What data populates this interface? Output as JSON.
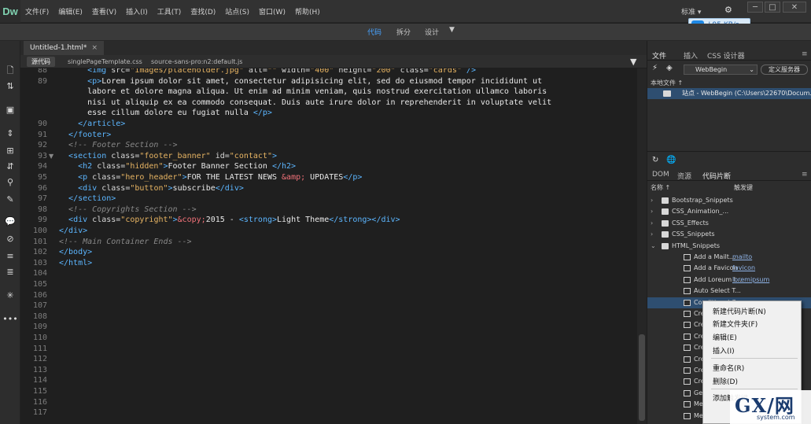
{
  "app": {
    "logo": "Dw"
  },
  "menu": [
    "文件(F)",
    "编辑(E)",
    "查看(V)",
    "插入(I)",
    "工具(T)",
    "查找(D)",
    "站点(S)",
    "窗口(W)",
    "帮助(H)"
  ],
  "workspace": {
    "label": "标准",
    "arrow": "▾"
  },
  "window_controls": [
    "─",
    "□",
    "✕"
  ],
  "speed": {
    "value": "↓95 KB/s"
  },
  "view_modes": {
    "code": "代码",
    "split": "拆分",
    "design": "设计",
    "active": "code"
  },
  "document": {
    "tab": "Untitled-1.html*",
    "close": "×"
  },
  "related_files": [
    "源代码",
    "singlePageTemplate.css",
    "source-sans-pro:n2:default.js"
  ],
  "code_lines": [
    {
      "n": "88",
      "html": "      <span class='tag'>&lt;img</span> <span class='attr'>src=</span><span class='val'>\"images/placeholder.jpg\"</span> <span class='attr'>alt=</span><span class='val'>\"\"</span> <span class='attr'>width=</span><span class='val'>\"400\"</span> <span class='attr'>height=</span><span class='val'>\"200\"</span> <span class='attr'>class=</span><span class='val'>\"cards\"</span> <span class='tag'>/&gt;</span>"
    },
    {
      "n": "89",
      "html": "      <span class='tag'>&lt;p&gt;</span><span class='txt'>Lorem ipsum dolor sit amet, consectetur adipisicing elit, sed do eiusmod tempor incididunt ut</span>"
    },
    {
      "n": "",
      "html": "      <span class='txt'>labore et dolore magna aliqua. Ut enim ad minim veniam, quis nostrud exercitation ullamco laboris</span>"
    },
    {
      "n": "",
      "html": "      <span class='txt'>nisi ut aliquip ex ea commodo consequat. Duis aute irure dolor in reprehenderit in voluptate velit</span>"
    },
    {
      "n": "",
      "html": "      <span class='txt'>esse cillum dolore eu fugiat nulla </span><span class='tag'>&lt;/p&gt;</span>"
    },
    {
      "n": "90",
      "html": "    <span class='tag'>&lt;/article&gt;</span>"
    },
    {
      "n": "91",
      "html": "  <span class='tag'>&lt;/footer&gt;</span>"
    },
    {
      "n": "92",
      "html": "  <span class='cmt'>&lt;!-- Footer Section --&gt;</span>"
    },
    {
      "n": "93",
      "fold": "▼",
      "html": "  <span class='tag'>&lt;section</span> <span class='attr'>class=</span><span class='val'>\"footer_banner\"</span> <span class='attr'>id=</span><span class='val'>\"contact\"</span><span class='tag'>&gt;</span>"
    },
    {
      "n": "94",
      "html": "    <span class='tag'>&lt;h2</span> <span class='attr'>class=</span><span class='val'>\"hidden\"</span><span class='tag'>&gt;</span><span class='txt'>Footer Banner Section </span><span class='tag'>&lt;/h2&gt;</span>"
    },
    {
      "n": "95",
      "html": "    <span class='tag'>&lt;p</span> <span class='attr'>class=</span><span class='val'>\"hero_header\"</span><span class='tag'>&gt;</span><span class='txt'>FOR THE LATEST NEWS </span><span class='ent'>&amp;amp;</span><span class='txt'> UPDATES</span><span class='tag'>&lt;/p&gt;</span>"
    },
    {
      "n": "96",
      "html": "    <span class='tag'>&lt;div</span> <span class='attr'>class=</span><span class='val'>\"button\"</span><span class='tag'>&gt;</span><span class='txt'>subscribe</span><span class='tag'>&lt;/div&gt;</span>"
    },
    {
      "n": "97",
      "html": "  <span class='tag'>&lt;/section&gt;</span>"
    },
    {
      "n": "98",
      "html": "  <span class='cmt'>&lt;!-- Copyrights Section --&gt;</span>"
    },
    {
      "n": "99",
      "html": "  <span class='tag'>&lt;div</span> <span class='attr'>class=</span><span class='val'>\"copyright\"</span><span class='tag'>&gt;</span><span class='ent'>&amp;copy;</span><span class='txt'>2015 - </span><span class='tag'>&lt;strong&gt;</span><span class='txt'>Light Theme</span><span class='tag'>&lt;/strong&gt;&lt;/div&gt;</span>"
    },
    {
      "n": "100",
      "html": "<span class='tag'>&lt;/div&gt;</span>"
    },
    {
      "n": "101",
      "html": "<span class='cmt'>&lt;!-- Main Container Ends --&gt;</span>"
    },
    {
      "n": "102",
      "html": "<span class='tag'>&lt;/body&gt;</span>"
    },
    {
      "n": "103",
      "html": "<span class='tag'>&lt;/html&gt;</span>"
    },
    {
      "n": "104",
      "html": ""
    },
    {
      "n": "105",
      "html": ""
    },
    {
      "n": "106",
      "html": ""
    },
    {
      "n": "107",
      "html": ""
    },
    {
      "n": "108",
      "html": ""
    },
    {
      "n": "109",
      "html": ""
    },
    {
      "n": "110",
      "html": ""
    },
    {
      "n": "111",
      "html": ""
    },
    {
      "n": "112",
      "html": ""
    },
    {
      "n": "113",
      "html": ""
    },
    {
      "n": "114",
      "html": ""
    },
    {
      "n": "115",
      "html": ""
    },
    {
      "n": "116",
      "html": ""
    },
    {
      "n": "117",
      "html": ""
    }
  ],
  "files_panel": {
    "tabs": [
      "文件",
      "插入",
      "CSS 设计器"
    ],
    "site_select": "WebBegin",
    "define_server": "定义服务器",
    "local_files": "本地文件 ↑",
    "site_row": "站点 - WebBegin (C:\\Users\\22670\\Docum..."
  },
  "snippets_panel": {
    "tabs": [
      "DOM",
      "资源",
      "代码片断"
    ],
    "col_name": "名称 ↑",
    "col_trigger": "触发键",
    "items": [
      {
        "type": "folder",
        "label": "Bootstrap_Snippets",
        "twisty": "›"
      },
      {
        "type": "folder",
        "label": "CSS_Animation_...",
        "twisty": "›"
      },
      {
        "type": "folder",
        "label": "CSS_Effects",
        "twisty": "›"
      },
      {
        "type": "folder",
        "label": "CSS_Snippets",
        "twisty": "›"
      },
      {
        "type": "folder",
        "label": "HTML_Snippets",
        "twisty": "⌄"
      },
      {
        "type": "file",
        "label": "Add a Mailt...",
        "link": "mailto"
      },
      {
        "type": "file",
        "label": "Add a Favicon",
        "link": "favicon"
      },
      {
        "type": "file",
        "label": "Add Loreum I...",
        "link": "loremipsum"
      },
      {
        "type": "file",
        "label": "Auto Select T..."
      },
      {
        "type": "file",
        "label": "Conditional C...",
        "selected": true
      },
      {
        "type": "file",
        "label": "Cre..."
      },
      {
        "type": "file",
        "label": "Cre..."
      },
      {
        "type": "file",
        "label": "Cre..."
      },
      {
        "type": "file",
        "label": "Cre..."
      },
      {
        "type": "file",
        "label": "Cre..."
      },
      {
        "type": "file",
        "label": "Cre..."
      },
      {
        "type": "file",
        "label": "Cre..."
      },
      {
        "type": "file",
        "label": "Ge..."
      },
      {
        "type": "file",
        "label": "Me..."
      },
      {
        "type": "file",
        "label": "Meta Tags for..."
      }
    ]
  },
  "context_menu": [
    "新建代码片断(N)",
    "新建文件夹(F)",
    "编辑(E)",
    "插入(I)",
    "重命名(R)",
    "删除(D)",
    "添加触发键..."
  ],
  "watermark": {
    "main": "GX/网",
    "sub": "system.com"
  }
}
